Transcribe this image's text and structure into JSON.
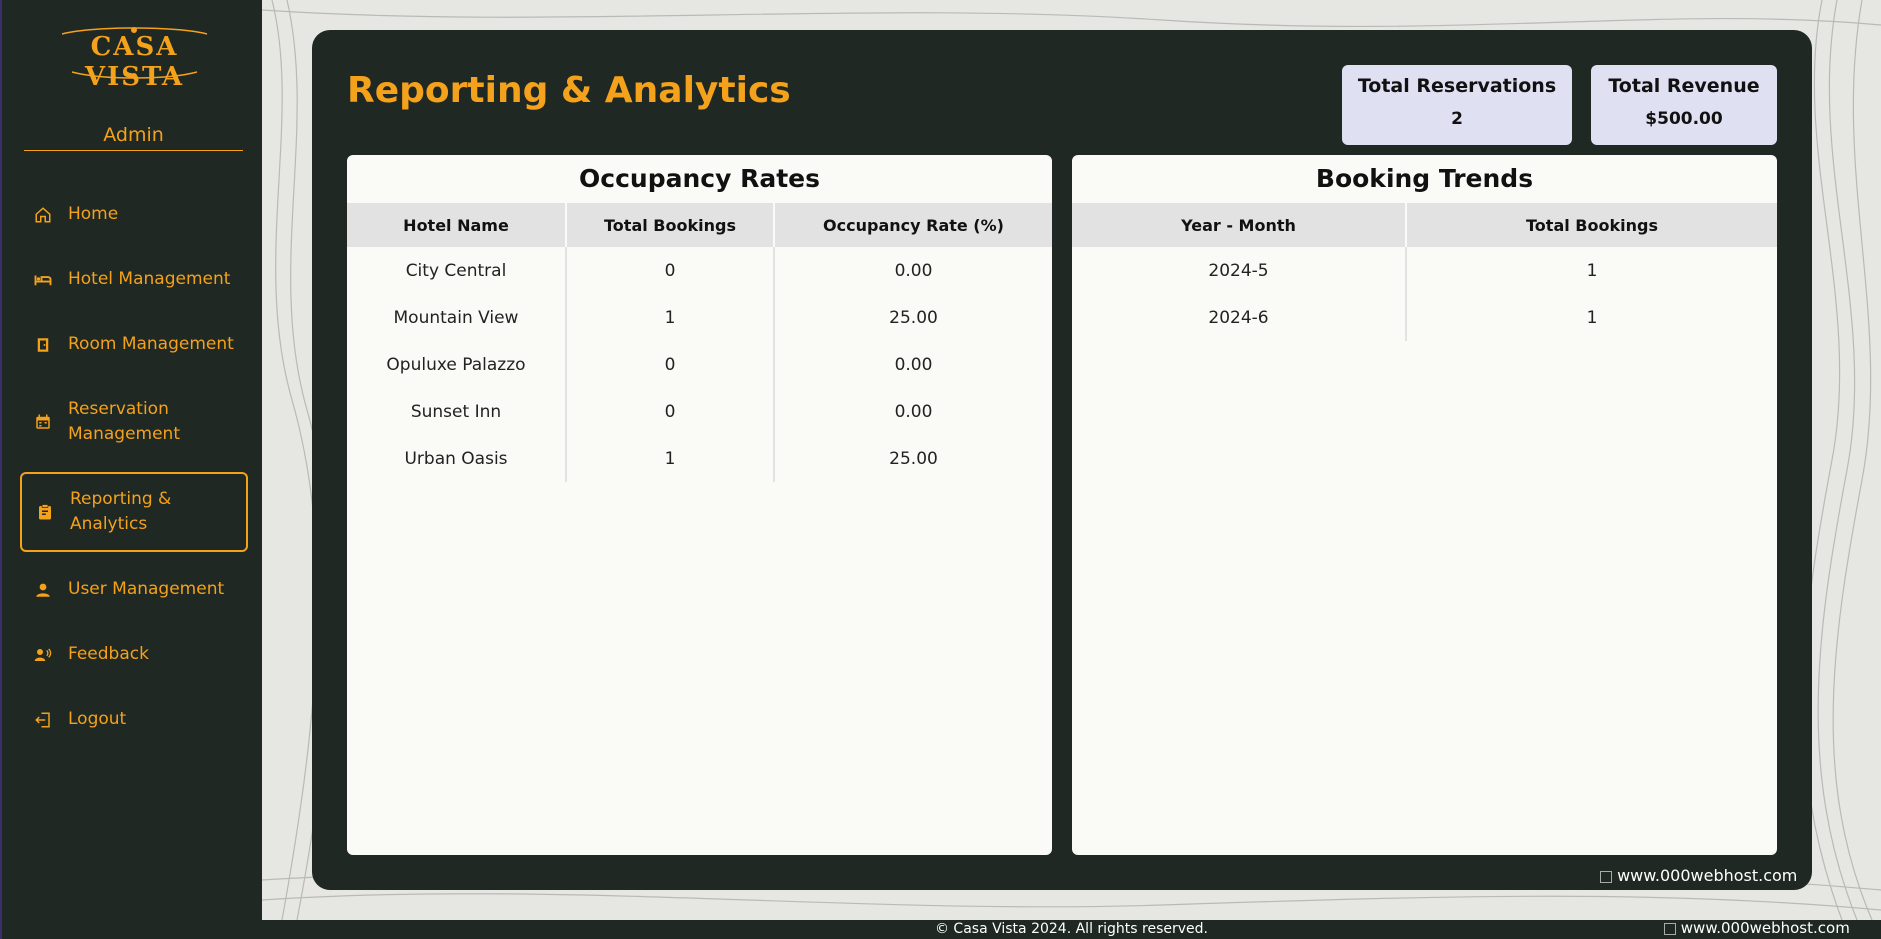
{
  "brand": {
    "name": "CASA VISTA"
  },
  "sidebar": {
    "role": "Admin",
    "items": [
      {
        "label": "Home",
        "icon": "home-icon"
      },
      {
        "label": "Hotel Management",
        "icon": "bed-icon"
      },
      {
        "label": "Room Management",
        "icon": "door-icon"
      },
      {
        "label": "Reservation Management",
        "icon": "calendar-icon"
      },
      {
        "label": "Reporting & Analytics",
        "icon": "report-icon",
        "active": true
      },
      {
        "label": "User Management",
        "icon": "user-icon"
      },
      {
        "label": "Feedback",
        "icon": "feedback-icon"
      },
      {
        "label": "Logout",
        "icon": "logout-icon"
      }
    ]
  },
  "main": {
    "title": "Reporting & Analytics",
    "stats": {
      "reservations_label": "Total Reservations",
      "reservations_value": "2",
      "revenue_label": "Total Revenue",
      "revenue_value": "$500.00"
    },
    "occupancy": {
      "title": "Occupancy Rates",
      "headers": [
        "Hotel Name",
        "Total Bookings",
        "Occupancy Rate (%)"
      ],
      "rows": [
        [
          "City Central",
          "0",
          "0.00"
        ],
        [
          "Mountain View",
          "1",
          "25.00"
        ],
        [
          "Opuluxe Palazzo",
          "0",
          "0.00"
        ],
        [
          "Sunset Inn",
          "0",
          "0.00"
        ],
        [
          "Urban Oasis",
          "1",
          "25.00"
        ]
      ]
    },
    "trends": {
      "title": "Booking Trends",
      "headers": [
        "Year - Month",
        "Total Bookings"
      ],
      "rows": [
        [
          "2024-5",
          "1"
        ],
        [
          "2024-6",
          "1"
        ]
      ]
    }
  },
  "hosting": {
    "alt_text": "www.000webhost.com"
  },
  "footer": {
    "text": "© Casa Vista 2024. All rights reserved."
  },
  "colors": {
    "accent": "#f4a11c",
    "dark": "#1f2822",
    "stat_bg": "#dfe0f2"
  }
}
